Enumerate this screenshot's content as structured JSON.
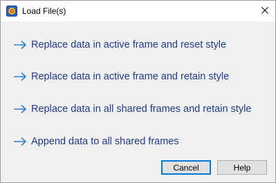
{
  "dialog": {
    "title": "Load File(s)",
    "app_icon": "tecplot-icon",
    "close_icon": "close-icon"
  },
  "options": [
    {
      "label": "Replace data in active frame and reset style",
      "icon": "arrow-right-icon"
    },
    {
      "label": "Replace data in active frame and retain style",
      "icon": "arrow-right-icon"
    },
    {
      "label": "Replace data in all shared frames and retain style",
      "icon": "arrow-right-icon"
    },
    {
      "label": "Append data to all shared frames",
      "icon": "arrow-right-icon"
    }
  ],
  "buttons": {
    "cancel_label": "Cancel",
    "help_label": "Help"
  },
  "colors": {
    "link_text": "#1f3a87",
    "arrow": "#2e7fd3",
    "dialog_body": "#f0f0f0",
    "default_button_border": "#0078d7"
  }
}
